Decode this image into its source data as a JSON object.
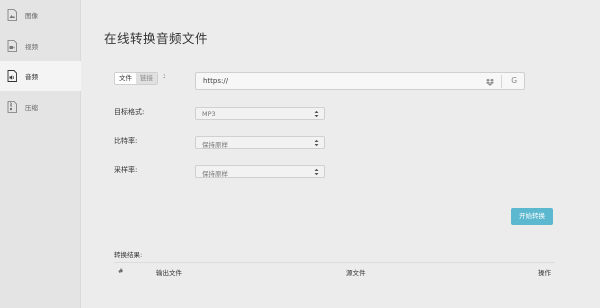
{
  "sidebar": {
    "items": [
      {
        "label": "图像",
        "icon": "image-icon"
      },
      {
        "label": "视频",
        "icon": "video-icon"
      },
      {
        "label": "音频",
        "icon": "audio-file-icon",
        "active": true
      },
      {
        "label": "压缩",
        "icon": "archive-icon"
      }
    ]
  },
  "main": {
    "title": "在线转换音频文件",
    "file_toggle": {
      "file": "文件",
      "link": "链接"
    },
    "colon": ":",
    "url_input": {
      "value": "https://"
    },
    "google_icon_text": "G",
    "format": {
      "label": "目标格式:",
      "value": "MP3"
    },
    "bitrate": {
      "label": "比特率:",
      "value": "保持原样"
    },
    "samplerate": {
      "label": "采样率:",
      "value": "保持原样"
    },
    "start_button": "开始转换",
    "results": {
      "label": "转换结果:",
      "columns": [
        "#",
        "输出文件",
        "源文件",
        "操作"
      ]
    }
  },
  "colors": {
    "accent": "#5bb8cf",
    "sidebar_bg": "#e4e4e4",
    "page_bg": "#ececec"
  }
}
